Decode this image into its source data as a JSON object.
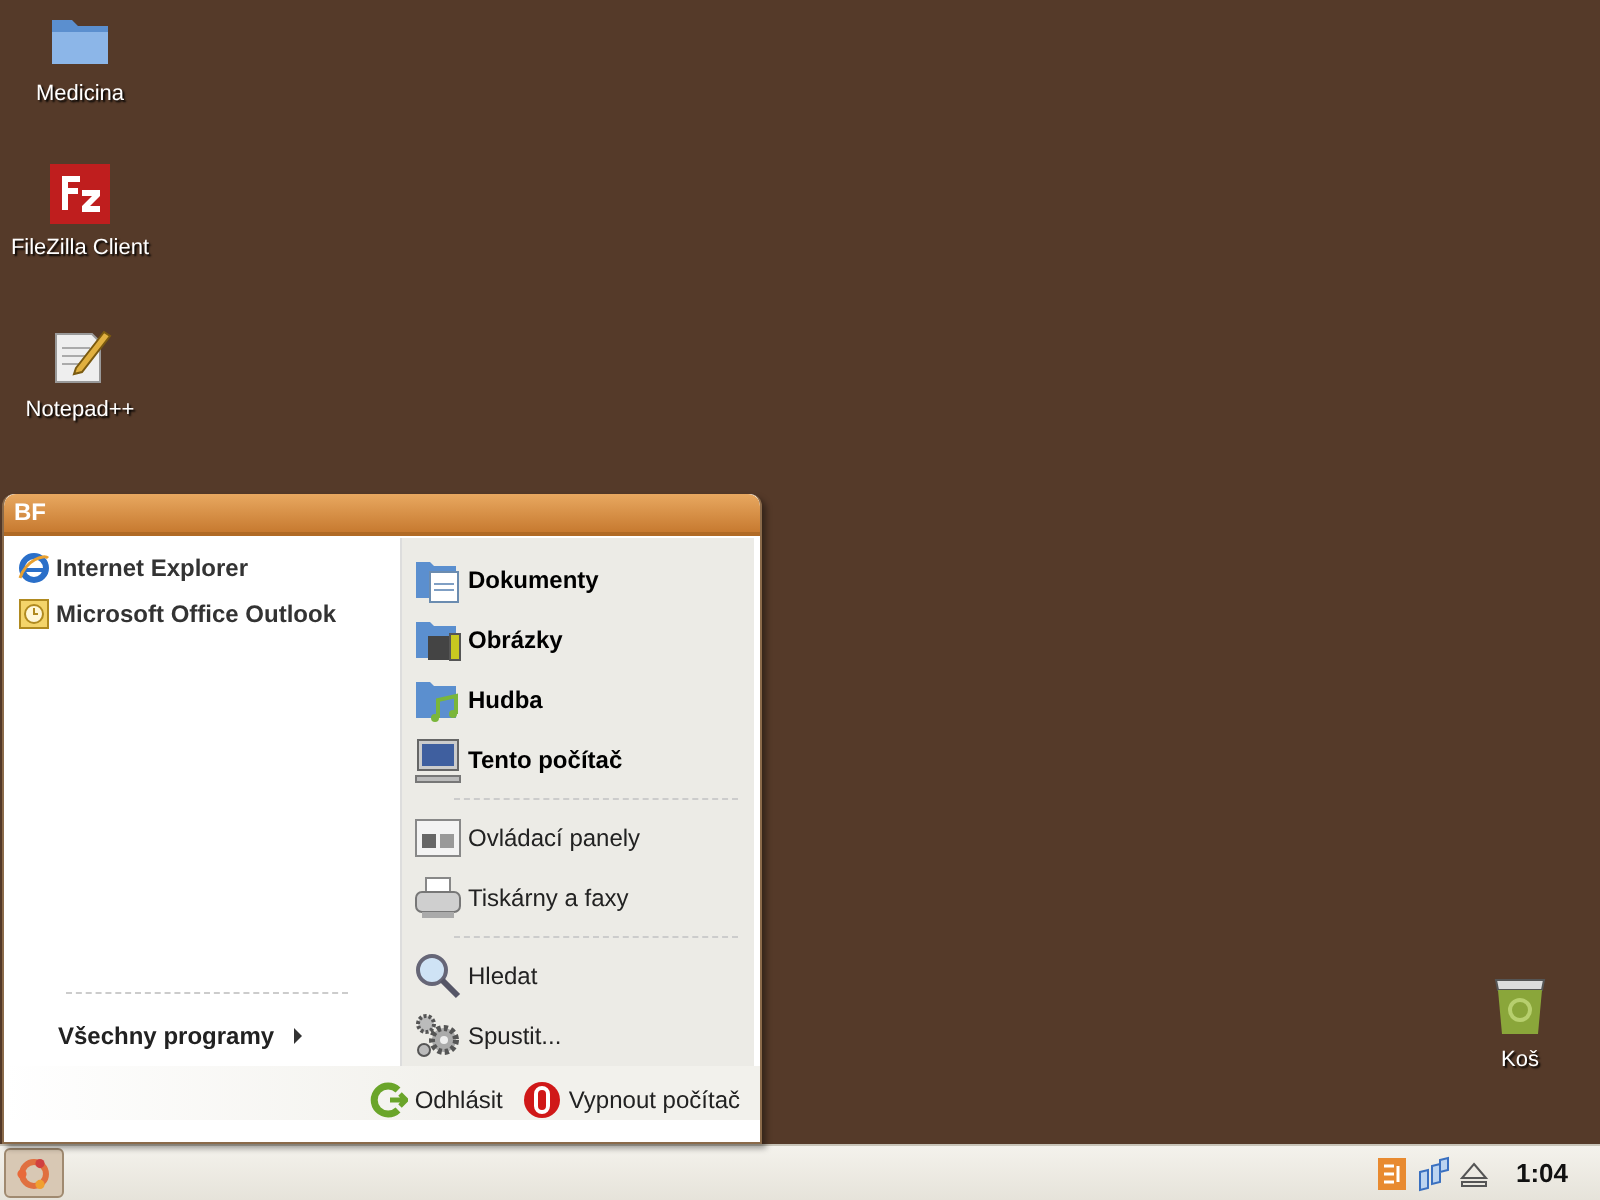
{
  "desktop_icons": [
    {
      "label": "Medicina",
      "kind": "folder"
    },
    {
      "label": "FileZilla Client",
      "kind": "filezilla"
    },
    {
      "label": "Notepad++",
      "kind": "notepad"
    },
    {
      "label": "Koš",
      "kind": "trash"
    }
  ],
  "start_menu": {
    "user": "BF",
    "pinned": [
      {
        "label": "Internet Explorer",
        "kind": "ie"
      },
      {
        "label": "Microsoft Office Outlook",
        "kind": "outlook"
      }
    ],
    "all_programs": "Všechny programy",
    "right_groups": [
      {
        "kind": "places",
        "items": [
          {
            "label": "Dokumenty",
            "kind": "documents"
          },
          {
            "label": "Obrázky",
            "kind": "pictures"
          },
          {
            "label": "Hudba",
            "kind": "music"
          },
          {
            "label": "Tento počítač",
            "kind": "computer"
          }
        ]
      },
      {
        "kind": "settings",
        "items": [
          {
            "label": "Ovládací panely",
            "kind": "control"
          },
          {
            "label": "Tiskárny a faxy",
            "kind": "printer"
          }
        ]
      },
      {
        "kind": "tools",
        "items": [
          {
            "label": "Hledat",
            "kind": "search"
          },
          {
            "label": "Spustit...",
            "kind": "run"
          }
        ]
      }
    ],
    "footer_buttons": [
      {
        "label": "Odhlásit",
        "kind": "logoff"
      },
      {
        "label": "Vypnout počítač",
        "kind": "shutdown"
      }
    ]
  },
  "taskbar": {
    "clock": "1:04"
  }
}
